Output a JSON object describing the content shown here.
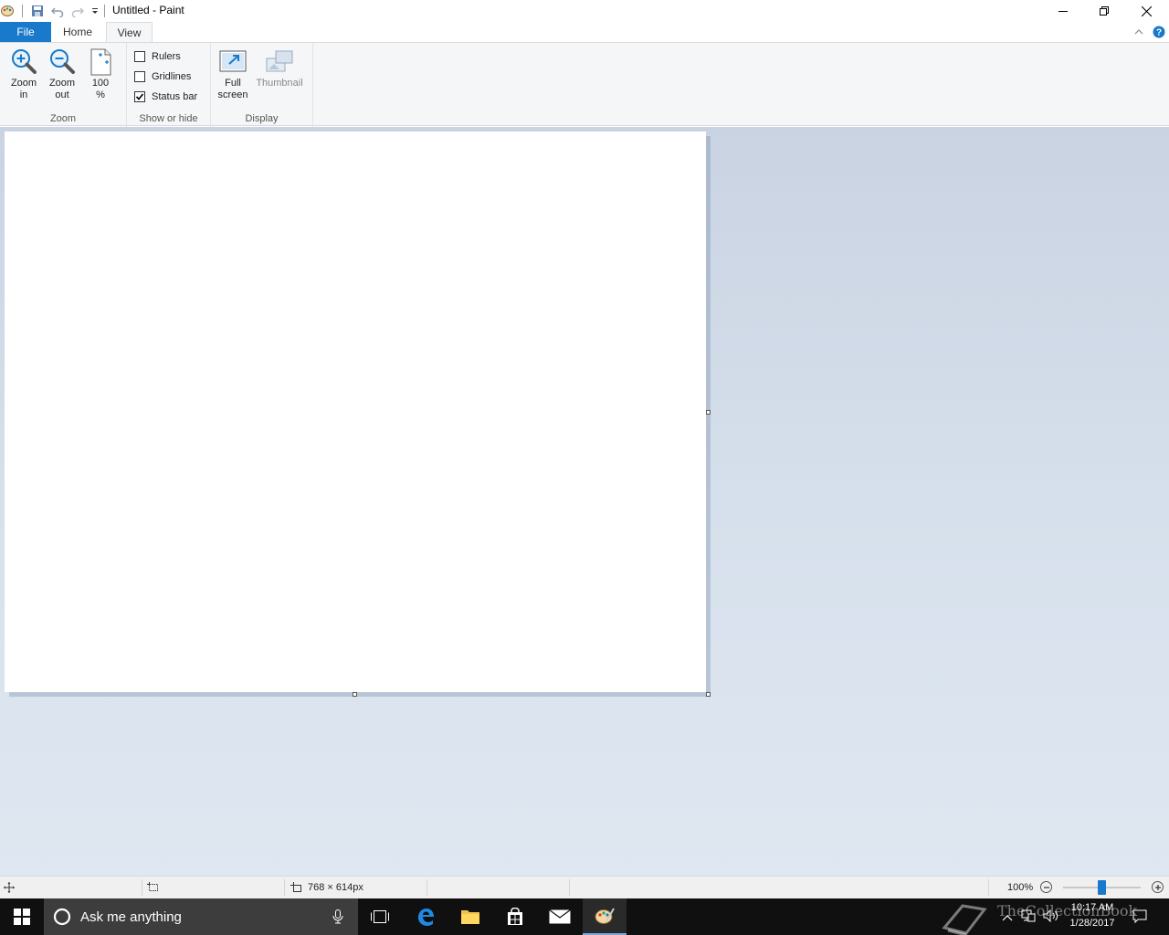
{
  "window": {
    "title": "Untitled - Paint"
  },
  "tabs": {
    "file": "File",
    "home": "Home",
    "view": "View"
  },
  "ribbon": {
    "zoom_group": {
      "label": "Zoom",
      "zoom_in": "Zoom\nin",
      "zoom_out": "Zoom\nout",
      "hundred": "100\n%"
    },
    "show_group": {
      "label": "Show or hide",
      "rulers": {
        "label": "Rulers",
        "checked": false
      },
      "gridlines": {
        "label": "Gridlines",
        "checked": false
      },
      "status_bar": {
        "label": "Status bar",
        "checked": true
      }
    },
    "display_group": {
      "label": "Display",
      "full_screen": "Full\nscreen",
      "thumbnail": "Thumbnail"
    }
  },
  "statusbar": {
    "image_size": "768 × 614px",
    "zoom_level": "100%",
    "zoom_percent": 100
  },
  "taskbar": {
    "search_placeholder": "Ask me anything",
    "time": "10:17 AM",
    "date": "1/28/2017",
    "watermark": "TheCollectionBook"
  },
  "colors": {
    "accent": "#1979ca",
    "workspace_top": "#c9d3e2",
    "workspace_bottom": "#dfe7f1",
    "taskbar": "#101010"
  }
}
